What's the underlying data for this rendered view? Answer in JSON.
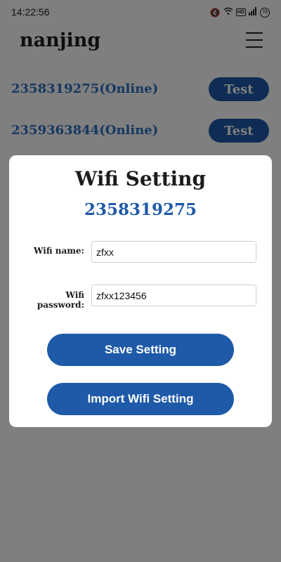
{
  "status_bar": {
    "time": "14:22:56",
    "hd_badge": "HD",
    "battery_level": "78",
    "icons": [
      "mute-icon",
      "wifi-icon",
      "hd-icon",
      "signal-icon",
      "battery-icon"
    ]
  },
  "header": {
    "title": "nanjing",
    "menu_icon": "hamburger-menu-icon"
  },
  "devices": [
    {
      "label": "2358319275(Online)",
      "test_label": "Test"
    },
    {
      "label": "2359363844(Online)",
      "test_label": "Test"
    }
  ],
  "dialog": {
    "title": "Wifi Setting",
    "device_id": "2358319275",
    "wifi_name_label": "Wifi name:",
    "wifi_name_value": "zfxx",
    "wifi_password_label": "Wifi password:",
    "wifi_password_value": "zfxx123456",
    "save_label": "Save Setting",
    "import_label": "Import Wifi Setting"
  },
  "colors": {
    "accent": "#1e5aa8",
    "link": "#2b6fbf",
    "overlay": "rgba(0,0,0,0.5)"
  }
}
